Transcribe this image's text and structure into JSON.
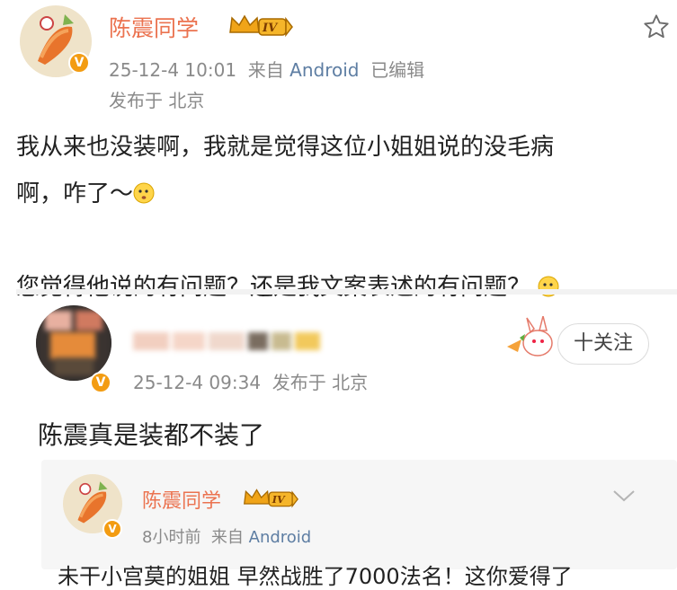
{
  "post": {
    "author": "陈震同学",
    "level": "IV",
    "date": "25-12-4 10:01",
    "source_prefix": "来自",
    "source": "Android",
    "edited": "已编辑",
    "location": "发布于 北京",
    "line1": "我从来也没装啊，我就是觉得这位小姐姐说的没毛病",
    "line2": "啊，咋了～",
    "line3": "您觉得他说的有问题？还是我文案表述的有问题？"
  },
  "comment": {
    "date": "25-12-4 09:34",
    "location": "发布于 北京",
    "follow_label": "十关注",
    "text": "陈震真是装都不装了"
  },
  "reply": {
    "author": "陈震同学",
    "level": "IV",
    "time": "8小时前",
    "source_prefix": "来自",
    "source": "Android",
    "partial_text": "未干小宫莫的姐姐  早然战胜了7000法名！这你爱得了"
  },
  "colors": {
    "name": "#eb7350",
    "meta": "#8a8a8a",
    "link": "#5e7ea3",
    "badge": "#f39c12"
  },
  "icons": [
    "star-icon",
    "crown-level-icon",
    "chevron-down-icon",
    "verified-v-icon",
    "thinking-emoji-icon"
  ]
}
